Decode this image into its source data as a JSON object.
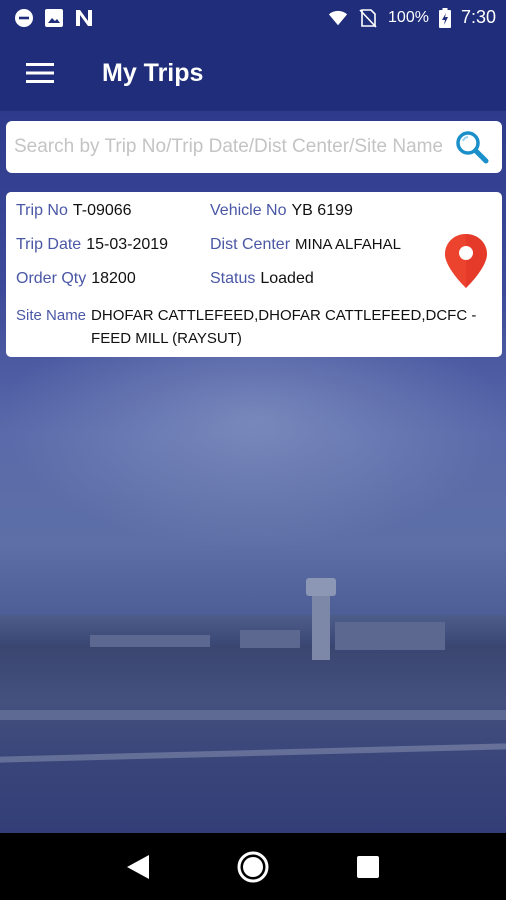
{
  "status_bar": {
    "battery_percent": "100%",
    "time": "7:30",
    "icons_left": [
      "minus-circle-icon",
      "image-icon",
      "n-app-icon"
    ],
    "icons_right": [
      "wifi-icon",
      "no-sim-icon",
      "battery-charging-icon"
    ]
  },
  "app_bar": {
    "title": "My Trips",
    "menu_icon": "hamburger-menu-icon",
    "color": "#1f2d7a"
  },
  "search": {
    "placeholder": "Search by Trip No/Trip Date/Dist Center/Site Name",
    "value": "",
    "icon": "search-icon",
    "icon_color": "#1a8fc9"
  },
  "trips": [
    {
      "trip_no_label": "Trip No",
      "trip_no": "T-09066",
      "vehicle_no_label": "Vehicle No",
      "vehicle_no": "YB 6199",
      "trip_date_label": "Trip Date",
      "trip_date": "15-03-2019",
      "dist_center_label": "Dist Center",
      "dist_center": "MINA ALFAHAL",
      "order_qty_label": "Order Qty",
      "order_qty": "18200",
      "status_label": "Status",
      "status": "Loaded",
      "site_name_label": "Site Name",
      "site_name": "DHOFAR CATTLEFEED,DHOFAR CATTLEFEED,DCFC - FEED MILL (RAYSUT)",
      "map_icon": "map-pin-icon",
      "map_icon_color": "#e53a2a"
    }
  ],
  "nav_bar": {
    "back_icon": "back-triangle-icon",
    "home_icon": "home-circle-icon",
    "recents_icon": "recents-square-icon"
  },
  "colors": {
    "label": "#4a57a5",
    "value": "#111111",
    "background": "#3d4a99"
  }
}
